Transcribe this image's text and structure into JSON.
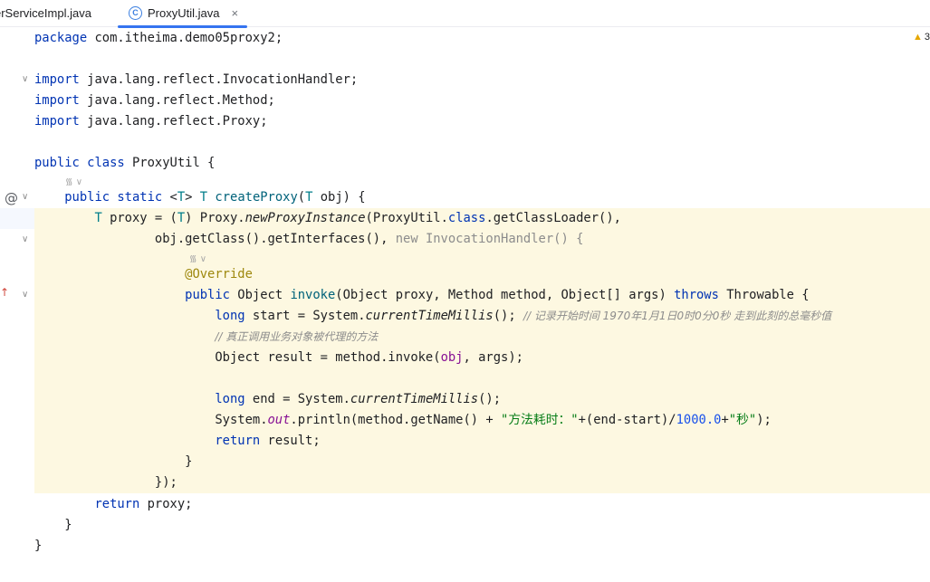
{
  "tabs": [
    {
      "label": "erServiceImpl.java"
    },
    {
      "label": "ProxyUtil.java",
      "icon": "C",
      "close": "×"
    }
  ],
  "inspection": {
    "count": "3",
    "icon": "warning-icon"
  },
  "inlay_hint": "᯾ ∨",
  "code": {
    "l1": {
      "a": "package",
      "b": " com.itheima.demo05proxy2;"
    },
    "l3": {
      "a": "import",
      "b": " java.lang.reflect.InvocationHandler;"
    },
    "l4": {
      "a": "import",
      "b": " java.lang.reflect.Method;"
    },
    "l5": {
      "a": "import",
      "b": " java.lang.reflect.Proxy;"
    },
    "l7": {
      "a": "public class",
      "b": " ProxyUtil {"
    },
    "l9": {
      "a": "    ",
      "b": "public static",
      "c": " <",
      "d": "T",
      "e": "> ",
      "f": "T",
      "g": " ",
      "h": "createProxy",
      "i": "(",
      "j": "T",
      "k": " obj) {"
    },
    "l10": {
      "a": "        ",
      "b": "T",
      "c": " proxy = (",
      "d": "T",
      "e": ") Proxy.",
      "f": "newProxyInstance",
      "g": "(ProxyUtil.",
      "h": "class",
      "i": ".getClassLoader(),"
    },
    "l11": {
      "a": "                obj.getClass().getInterfaces(), ",
      "b": "new InvocationHandler() {"
    },
    "l13": {
      "a": "                    ",
      "b": "@Override"
    },
    "l14": {
      "a": "                    ",
      "b": "public",
      "c": " Object ",
      "d": "invoke",
      "e": "(Object proxy, Method method, Object[] args) ",
      "f": "throws",
      "g": " Throwable {"
    },
    "l15": {
      "a": "                        ",
      "b": "long",
      "c": " start = System.",
      "d": "currentTimeMillis",
      "e": "(); ",
      "f": "// 记录开始时间 1970年1月1日0时0分0秒 走到此刻的总毫秒值"
    },
    "l16": {
      "a": "                        ",
      "b": "// 真正调用业务对象被代理的方法"
    },
    "l17": {
      "a": "                        Object result = method.invoke(",
      "b": "obj",
      "c": ", args);"
    },
    "l19": {
      "a": "                        ",
      "b": "long",
      "c": " end = System.",
      "d": "currentTimeMillis",
      "e": "();"
    },
    "l20": {
      "a": "                        System.",
      "b": "out",
      "c": ".println(method.getName() + ",
      "d": "\"方法耗时：\"",
      "e": "+(end-start)/",
      "f": "1000.0",
      "g": "+",
      "h": "\"秒\"",
      "i": ");"
    },
    "l21": {
      "a": "                        ",
      "b": "return",
      "c": " result;"
    },
    "l22": {
      "a": "                    }"
    },
    "l23": {
      "a": "                });"
    },
    "l24": {
      "a": "        ",
      "b": "return",
      "c": " proxy;"
    },
    "l25": {
      "a": "    }"
    },
    "l26": {
      "a": "}"
    }
  }
}
